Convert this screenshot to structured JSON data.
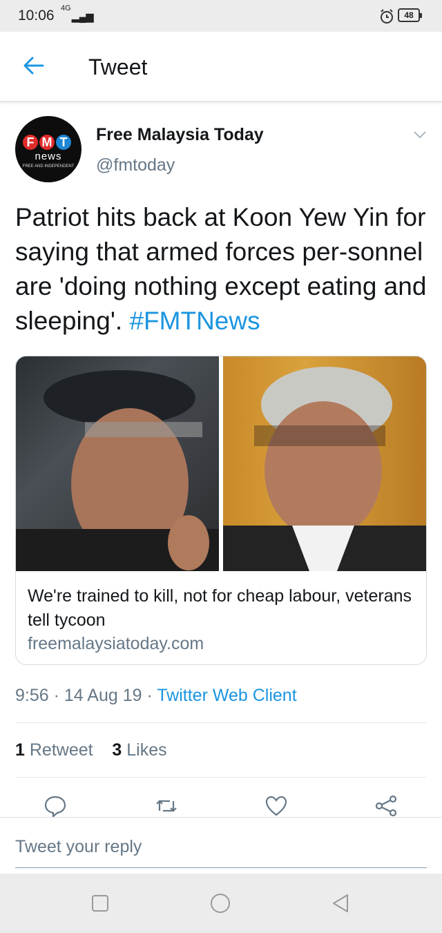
{
  "status_bar": {
    "time": "10:06",
    "signal_label": "4G",
    "battery": "48",
    "icons": [
      "alarm-icon",
      "battery-icon",
      "signal-icon"
    ]
  },
  "header": {
    "title": "Tweet"
  },
  "tweet": {
    "author_name": "Free Malaysia Today",
    "author_handle": "@fmtoday",
    "avatar": {
      "letters": [
        "F",
        "M",
        "T"
      ],
      "subtitle": "news",
      "tagline": "FREE AND INDEPENDENT"
    },
    "text": "Patriot hits back at Koon Yew Yin for saying that armed forces per-sonnel are 'doing nothing except eating and sleeping'.",
    "hashtag": "#FMTNews",
    "card": {
      "title": "We're trained to kill, not for cheap labour, veterans tell tycoon",
      "url": "freemalaysiatoday.com"
    },
    "time": "9:56",
    "date": "14 Aug 19",
    "client": "Twitter Web Client",
    "retweet_count": "1",
    "retweet_label": "Retweet",
    "like_count": "3",
    "like_label": "Likes"
  },
  "reply": {
    "placeholder": "Tweet your reply"
  },
  "colors": {
    "accent": "#1b95e0",
    "text_primary": "#14171a",
    "text_secondary": "#657786",
    "avatar_red": "#e02b2b",
    "avatar_blue": "#1f86d4"
  }
}
